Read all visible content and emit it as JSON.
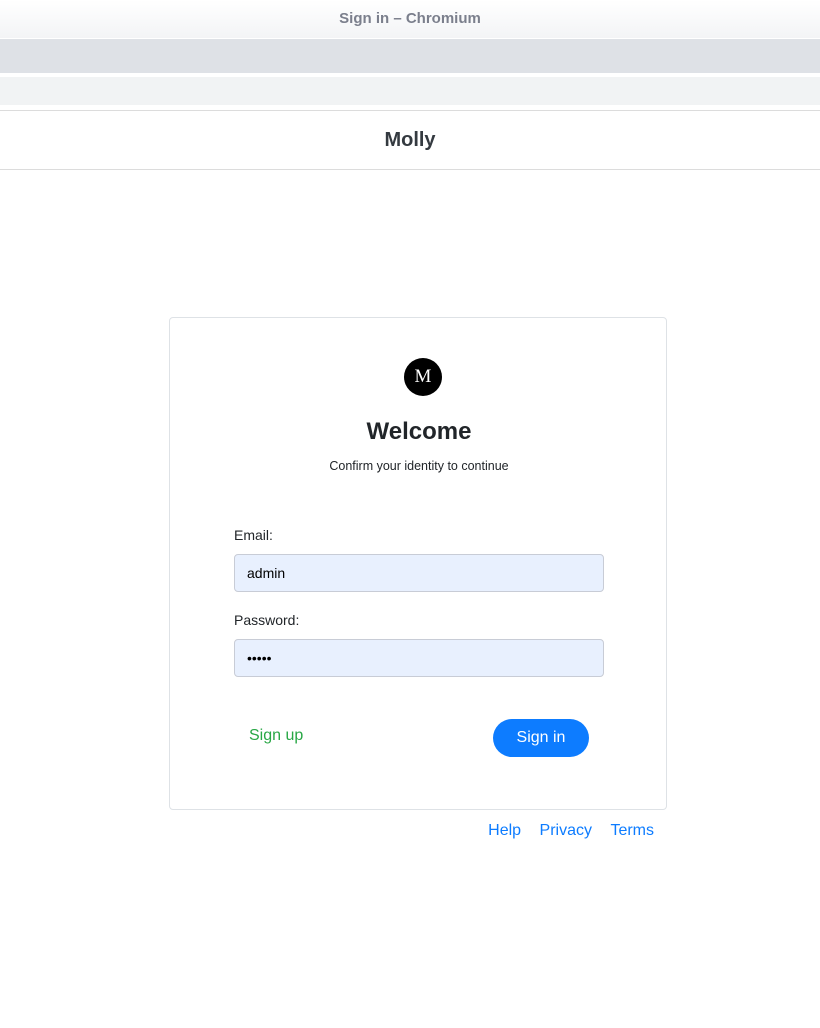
{
  "window": {
    "title": "Sign in – Chromium"
  },
  "app": {
    "name": "Molly"
  },
  "card": {
    "logo_letter": "M",
    "heading": "Welcome",
    "subtitle": "Confirm your identity to continue",
    "email_label": "Email:",
    "email_value": "admin",
    "password_label": "Password:",
    "password_value": "admin",
    "signup_label": "Sign up",
    "signin_label": "Sign in"
  },
  "footer": {
    "links": [
      "Help",
      "Privacy",
      "Terms"
    ]
  },
  "colors": {
    "primary": "#0d7cff",
    "success": "#28a745",
    "input_bg": "#e8f0fe"
  }
}
